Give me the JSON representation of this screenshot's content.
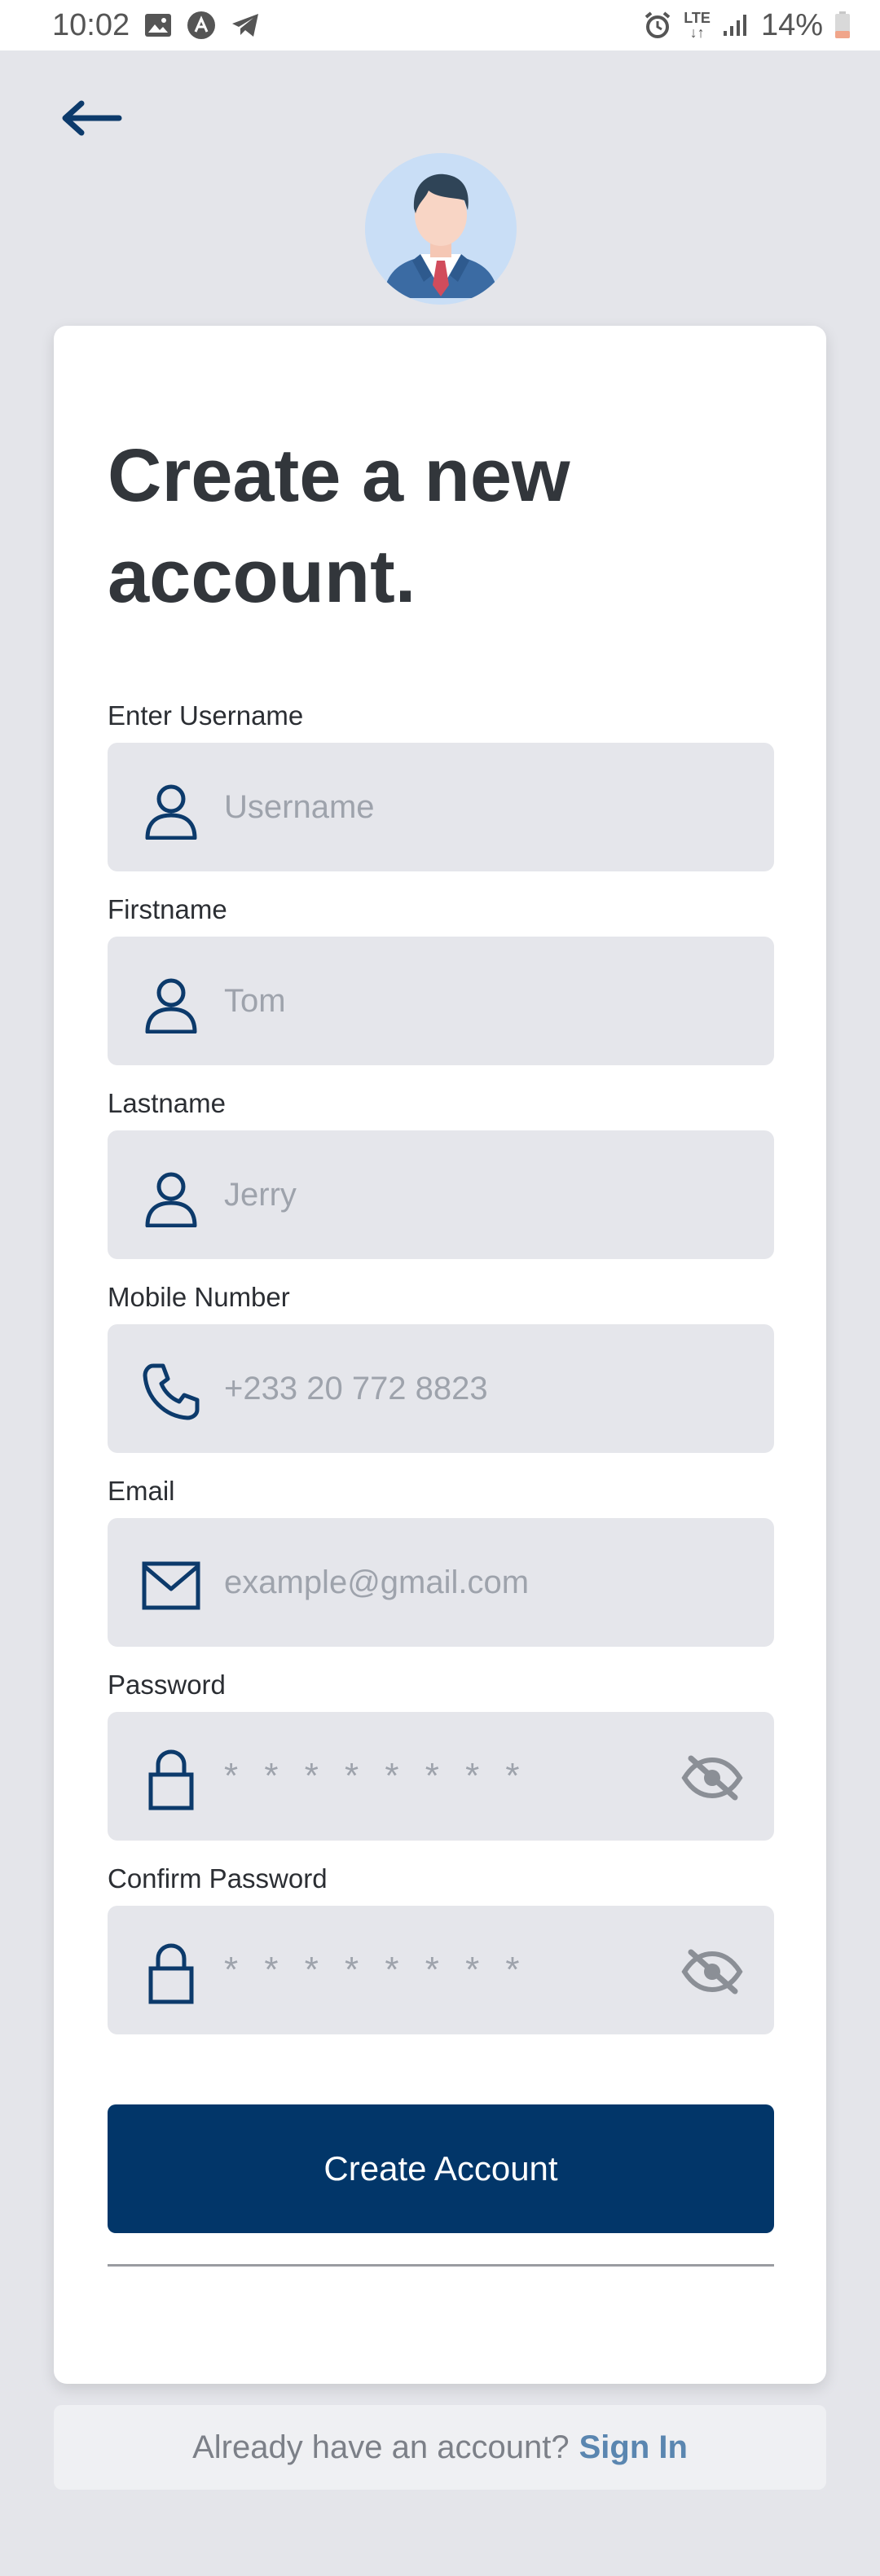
{
  "status_bar": {
    "time": "10:02",
    "left_icons": [
      "image-icon",
      "app-badge-icon",
      "telegram-icon"
    ],
    "lte_top": "LTE",
    "lte_bottom": "↓↑",
    "battery_text": "14%",
    "battery_color": "#f0a58a"
  },
  "header": {
    "back_icon": "arrow-left-icon",
    "avatar_icon": "businessman-avatar"
  },
  "title": "Create a new account.",
  "fields": {
    "username": {
      "label": "Enter Username",
      "placeholder": "Username",
      "icon": "person-icon"
    },
    "firstname": {
      "label": "Firstname",
      "placeholder": "Tom",
      "icon": "person-icon"
    },
    "lastname": {
      "label": "Lastname",
      "placeholder": "Jerry",
      "icon": "person-icon"
    },
    "mobile": {
      "label": "Mobile Number",
      "placeholder": "+233 20 772 8823",
      "icon": "phone-icon"
    },
    "email": {
      "label": "Email",
      "placeholder": "example@gmail.com",
      "icon": "mail-icon"
    },
    "password": {
      "label": "Password",
      "placeholder": "* * * * * * * *",
      "icon": "lock-icon",
      "toggle_icon": "eye-off-icon"
    },
    "confirm_password": {
      "label": "Confirm Password",
      "placeholder": "* * * * * * * *",
      "icon": "lock-icon",
      "toggle_icon": "eye-off-icon"
    }
  },
  "create_button": {
    "label": "Create Account"
  },
  "signin": {
    "prompt": "Already have an account?",
    "link": "Sign In"
  },
  "colors": {
    "primary": "#023669",
    "background": "#e4e5ea",
    "field_bg": "#e5e6eb",
    "icon": "#0c3a6b",
    "link": "#5a86b0"
  }
}
